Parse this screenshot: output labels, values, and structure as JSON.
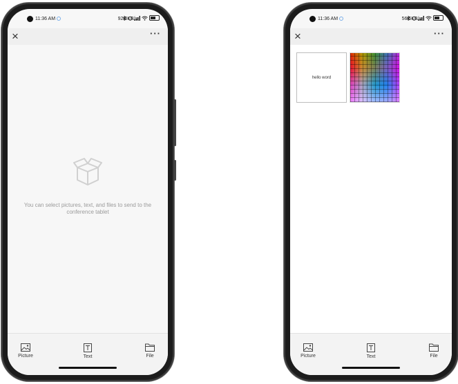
{
  "screens": [
    {
      "status": {
        "time": "11:36 AM",
        "speed": "92.8KB/s"
      },
      "appbar": {
        "close": "×",
        "more": "···"
      },
      "empty_state": {
        "icon": "box-icon",
        "message": "You can select pictures, text, and files to send to the conference tablet"
      },
      "toolbar": {
        "picture": "Picture",
        "text": "Text",
        "file": "File"
      }
    },
    {
      "status": {
        "time": "11:36 AM",
        "speed": "56.6KB/s"
      },
      "appbar": {
        "close": "×",
        "more": "···"
      },
      "items": [
        {
          "type": "text",
          "content": "hello word"
        },
        {
          "type": "image",
          "icon": "color-grid-image"
        }
      ],
      "toolbar": {
        "picture": "Picture",
        "text": "Text",
        "file": "File"
      }
    }
  ]
}
